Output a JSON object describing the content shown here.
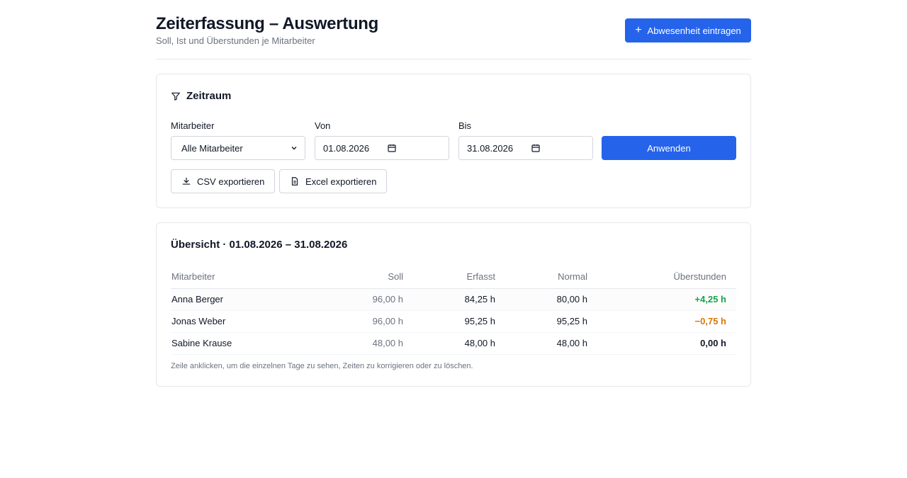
{
  "header": {
    "title": "Zeiterfassung – Auswertung",
    "subtitle": "Soll, Ist und Überstunden je Mitarbeiter",
    "absence_button": "Abwesenheit eintragen"
  },
  "filter": {
    "title": "Zeitraum",
    "employee_label": "Mitarbeiter",
    "employee_value": "Alle Mitarbeiter",
    "from_label": "Von",
    "from_value": "01.08.2026",
    "to_label": "Bis",
    "to_value": "31.08.2026",
    "apply_button": "Anwenden",
    "csv_button": "CSV exportieren",
    "excel_button": "Excel exportieren"
  },
  "overview": {
    "title": "Übersicht · 01.08.2026 – 31.08.2026",
    "columns": [
      "Mitarbeiter",
      "Soll",
      "Erfasst",
      "Normal",
      "Überstunden"
    ],
    "rows": [
      {
        "name": "Anna Berger",
        "soll": "96,00 h",
        "erfasst": "84,25 h",
        "normal": "80,00 h",
        "ueberstunden": "+4,25 h"
      },
      {
        "name": "Jonas Weber",
        "soll": "96,00 h",
        "erfasst": "95,25 h",
        "normal": "95,25 h",
        "ueberstunden": "−0,75 h"
      },
      {
        "name": "Sabine Krause",
        "soll": "48,00 h",
        "erfasst": "48,00 h",
        "normal": "48,00 h",
        "ueberstunden": "0,00 h"
      }
    ],
    "hint": "Zeile anklicken, um die einzelnen Tage zu sehen, Zeiten zu korrigieren oder zu löschen."
  },
  "colors": {
    "accent": "#2563eb",
    "positive": "#16a34a",
    "negative": "#d97706"
  },
  "icons": {
    "absence_button": "plus-icon",
    "filter_title": "filter-icon",
    "csv_button": "download-icon",
    "excel_button": "document-icon",
    "select": "chevron-down-icon",
    "date": "calendar-icon"
  }
}
